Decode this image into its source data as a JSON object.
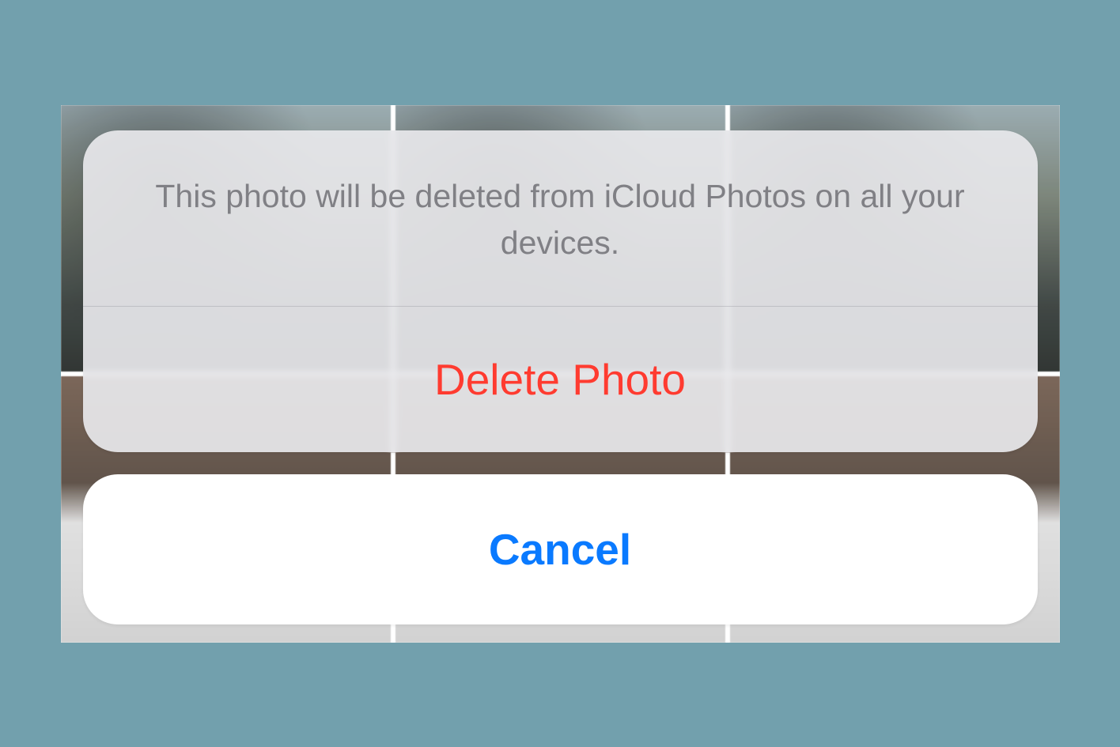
{
  "action_sheet": {
    "message": "This photo will be deleted from iCloud Photos on all your devices.",
    "destructive_label": "Delete Photo",
    "cancel_label": "Cancel"
  },
  "colors": {
    "destructive": "#ff3b30",
    "primary": "#0a7aff",
    "sheet_bg": "#e8e8eb",
    "page_bg": "#72a0ad"
  }
}
